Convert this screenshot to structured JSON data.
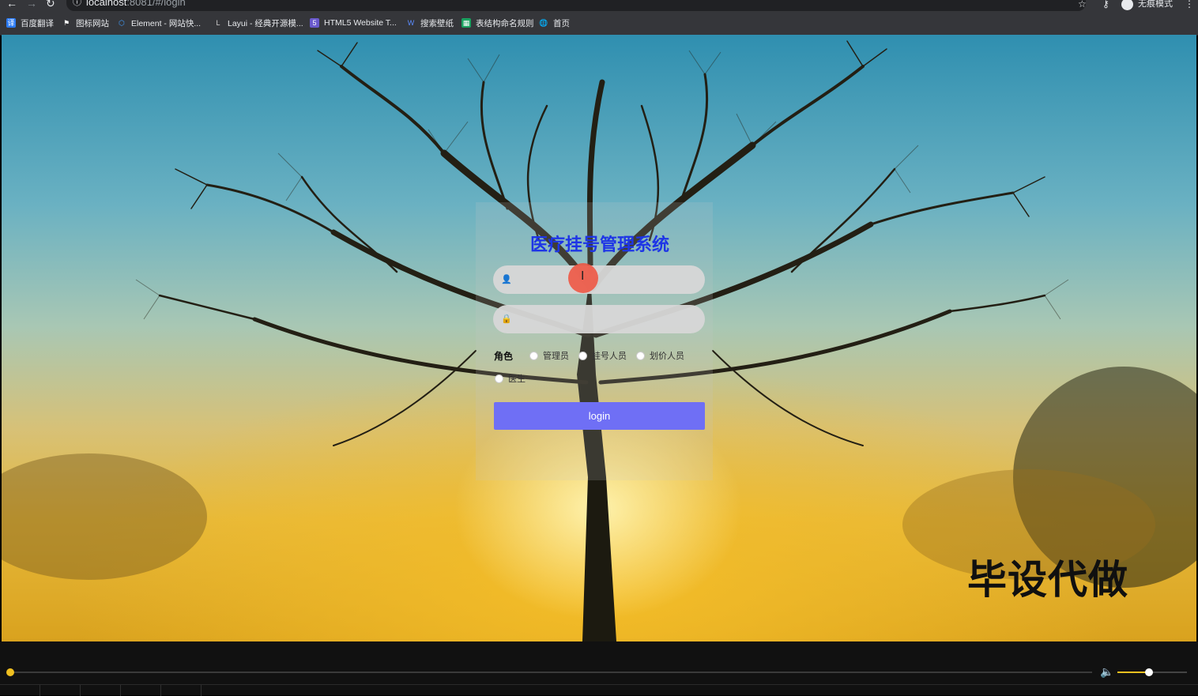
{
  "browser": {
    "url_host": "localhost",
    "url_path": ":8081/#/login",
    "profile_label": "无痕模式",
    "bookmarks": [
      {
        "label": "百度翻译",
        "color": "#2d7cf6",
        "icon": "translate-icon"
      },
      {
        "label": "图标网站",
        "color": "#ffffff",
        "icon": "flag-icon"
      },
      {
        "label": "Element - 网站快...",
        "color": "#409eff",
        "icon": "element-icon"
      },
      {
        "label": "Layui - 经典开源模...",
        "color": "#d0d0d0",
        "icon": "layui-icon"
      },
      {
        "label": "HTML5 Website T...",
        "color": "#6a5acd",
        "icon": "html5-icon"
      },
      {
        "label": "搜索壁纸",
        "color": "#3f6fe0",
        "icon": "wallpaper-icon"
      },
      {
        "label": "表结构命名规则",
        "color": "#1aa260",
        "icon": "table-icon"
      },
      {
        "label": "首页",
        "color": "#e8eaed",
        "icon": "globe-icon"
      }
    ]
  },
  "login": {
    "title": "医疗挂号管理系统",
    "username_placeholder": "",
    "password_placeholder": "",
    "role_label": "角色",
    "roles": [
      "管理员",
      "挂号人员",
      "划价人员",
      "医生"
    ],
    "button_label": "login"
  },
  "overlay": {
    "watermark": "毕设代做"
  },
  "player": {
    "progress": 0.0,
    "volume": 0.45,
    "accent_color": "#f0c020"
  }
}
